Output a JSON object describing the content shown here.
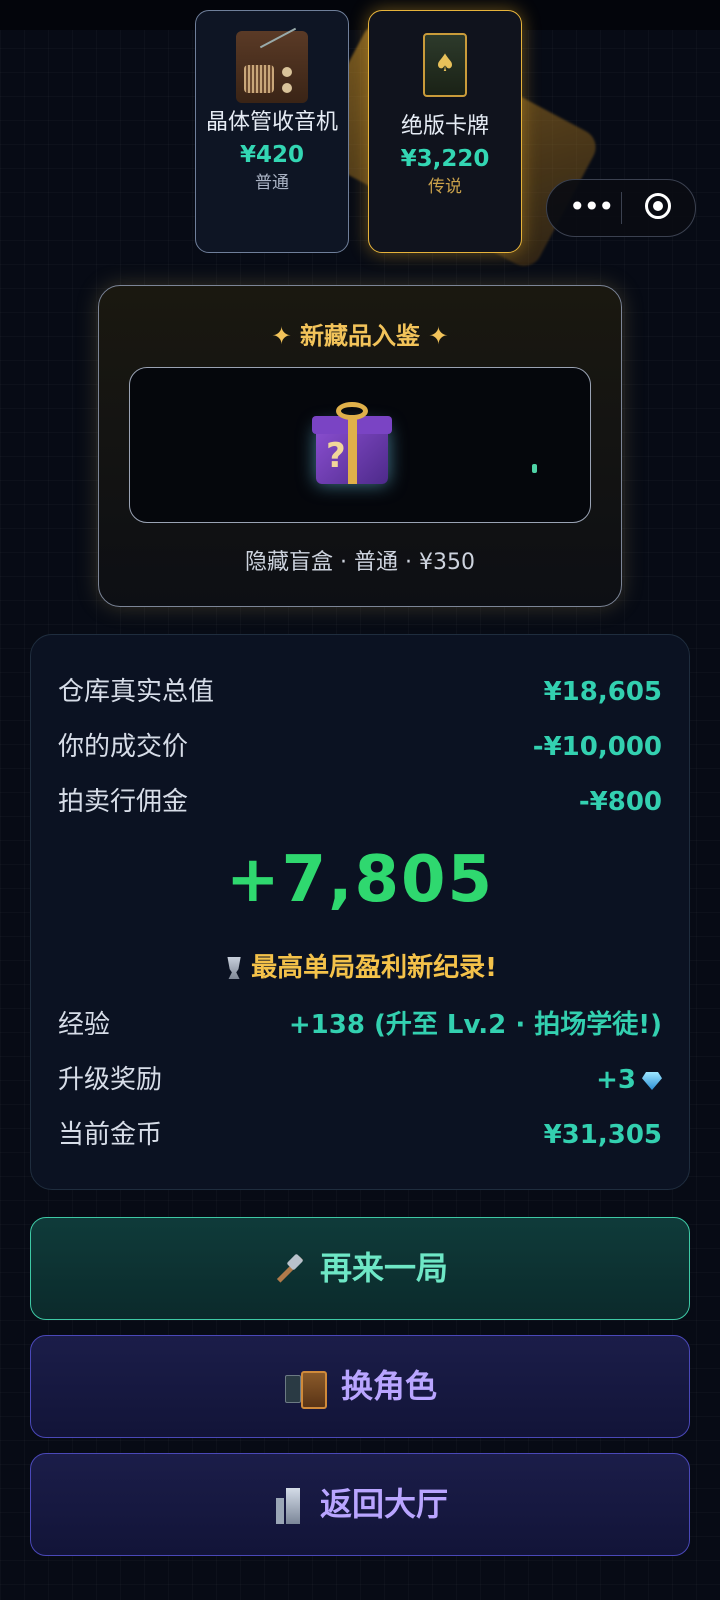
{
  "items": [
    {
      "name": "晶体管收音机",
      "price": "¥420",
      "rarity": "普通",
      "icon": "radio-icon"
    },
    {
      "name": "绝版卡牌",
      "price": "¥3,220",
      "rarity": "传说",
      "icon": "playing-card-icon"
    }
  ],
  "new_collection": {
    "title": "✦ 新藏品入鉴 ✦",
    "item_icon": "mystery-gift-box-icon",
    "caption": "隐藏盲盒 · 普通 · ¥350"
  },
  "results": {
    "warehouse_value_label": "仓库真实总值",
    "warehouse_value": "¥18,605",
    "your_price_label": "你的成交价",
    "your_price": "-¥10,000",
    "commission_label": "拍卖行佣金",
    "commission": "-¥800",
    "profit": "+7,805",
    "record_text": "最高单局盈利新纪录!",
    "exp_label": "经验",
    "exp_value": "+138 (升至 Lv.2 · 拍场学徒!)",
    "level_reward_label": "升级奖励",
    "level_reward_value": "+3",
    "coins_label": "当前金币",
    "coins_value": "¥31,305"
  },
  "buttons": {
    "again": "再来一局",
    "change_role": "换角色",
    "back_hall": "返回大厅"
  },
  "colors": {
    "accent_teal": "#33d0b0",
    "profit_green": "#2fd86f",
    "gold": "#f4c24a",
    "purple_button_text": "#b9a5ff",
    "background": "#070b15"
  }
}
